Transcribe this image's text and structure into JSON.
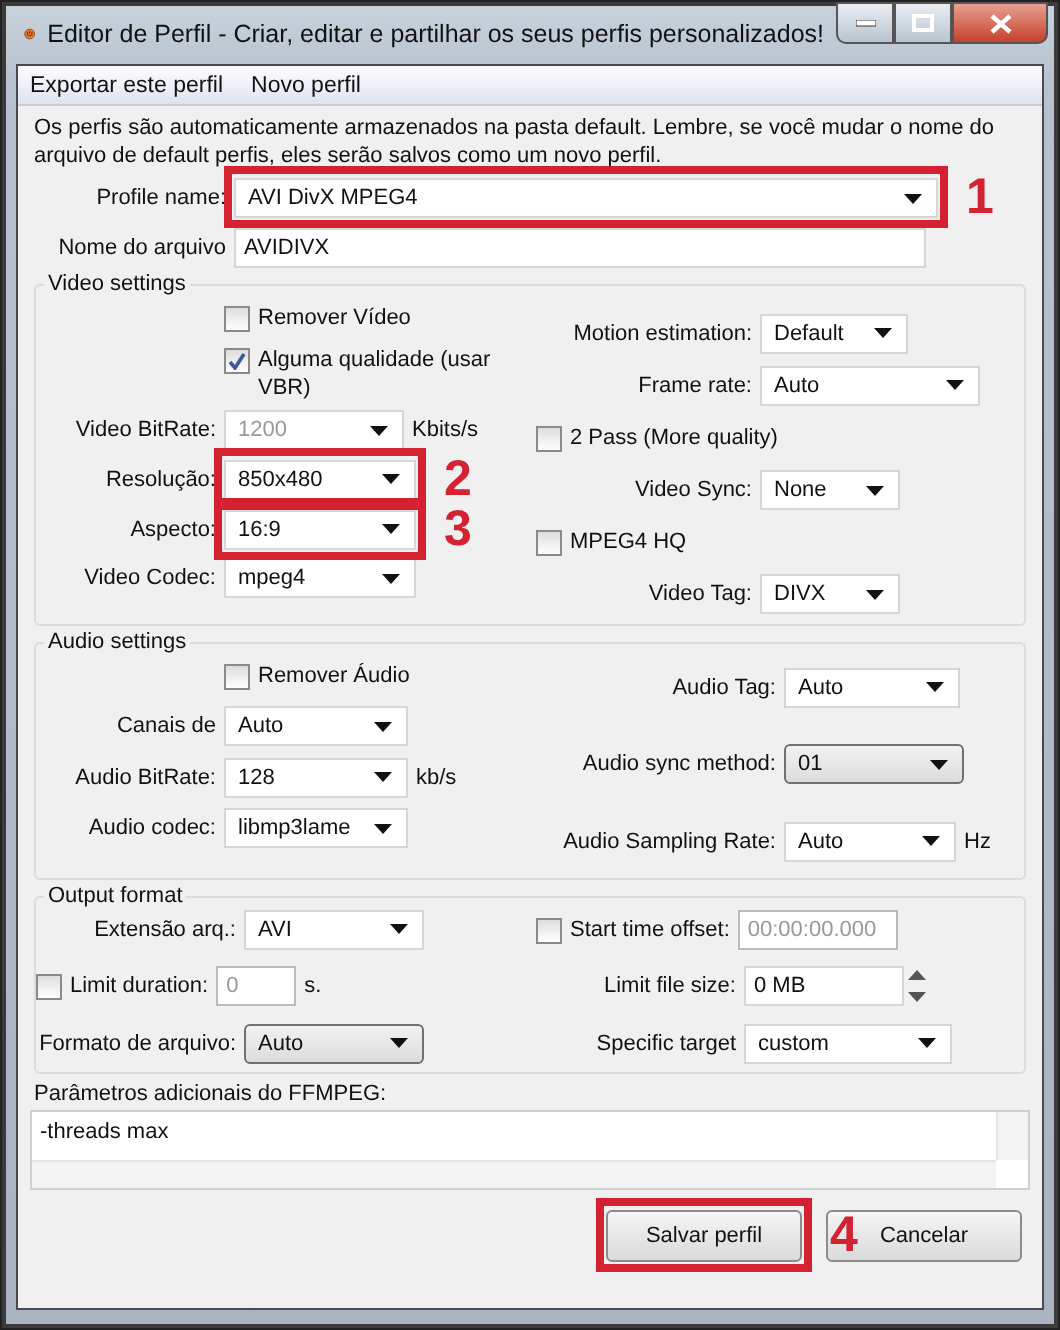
{
  "window": {
    "title": "Editor de Perfil - Criar, editar e partilhar os seus perfis personalizados!"
  },
  "menu": [
    "Exportar este perfil",
    "Novo perfil"
  ],
  "info": "Os perfis são automaticamente armazenados na pasta default. Lembre, se você mudar o nome do arquivo de default perfis, eles serão salvos como um novo perfil.",
  "profile_name": {
    "label": "Profile name:",
    "value": "AVI DivX MPEG4",
    "annotation": "1"
  },
  "file_name": {
    "label": "Nome do arquivo",
    "value": "AVIDIVX"
  },
  "sections": [
    {
      "title": "Video settings",
      "left": [
        {
          "kind": "checkbox",
          "label": "Remover Vídeo",
          "checked": false
        },
        {
          "kind": "checkbox",
          "label": "Alguma qualidade (usar VBR)",
          "checked": true
        },
        {
          "kind": "select",
          "label": "Video BitRate:",
          "value": "1200",
          "unit": "Kbits/s",
          "disabled": true
        },
        {
          "kind": "select",
          "label": "Resolução:",
          "value": "850x480",
          "annotation": "2"
        },
        {
          "kind": "select",
          "label": "Aspecto:",
          "value": "16:9",
          "annotation": "3"
        },
        {
          "kind": "select",
          "label": "Video Codec:",
          "value": "mpeg4"
        }
      ],
      "right": [
        {
          "kind": "select",
          "label": "Motion estimation:",
          "value": "Default"
        },
        {
          "kind": "select",
          "label": "Frame rate:",
          "value": "Auto"
        },
        {
          "kind": "checkbox",
          "label": "2 Pass (More quality)",
          "checked": false
        },
        {
          "kind": "select",
          "label": "Video Sync:",
          "value": "None"
        },
        {
          "kind": "checkbox",
          "label": "MPEG4 HQ",
          "checked": false
        },
        {
          "kind": "select",
          "label": "Video Tag:",
          "value": "DIVX"
        }
      ]
    },
    {
      "title": "Audio settings",
      "left": [
        {
          "kind": "checkbox",
          "label": "Remover Áudio",
          "checked": false
        },
        {
          "kind": "select",
          "label": "Canais de",
          "value": "Auto"
        },
        {
          "kind": "select",
          "label": "Audio BitRate:",
          "value": "128",
          "unit": "kb/s"
        },
        {
          "kind": "select",
          "label": "Audio codec:",
          "value": "libmp3lame"
        }
      ],
      "right": [
        {
          "kind": "select",
          "label": "Audio Tag:",
          "value": "Auto"
        },
        {
          "kind": "combo-button",
          "label": "Audio sync method:",
          "value": "01"
        },
        {
          "kind": "select",
          "label": "Audio Sampling Rate:",
          "value": "Auto",
          "unit": "Hz"
        }
      ]
    },
    {
      "title": "Output format",
      "left": [
        {
          "kind": "select",
          "label": "Extensão arq.:",
          "value": "AVI"
        },
        {
          "kind": "check-field",
          "label": "Limit duration:",
          "checked": false,
          "value": "0",
          "disabled": true,
          "unit": "s."
        },
        {
          "kind": "combo-button",
          "label": "Formato de arquivo:",
          "value": "Auto"
        }
      ],
      "right": [
        {
          "kind": "check-field",
          "label": "Start time offset:",
          "checked": false,
          "value": "00:00:00.000",
          "disabled": true
        },
        {
          "kind": "spin",
          "label": "Limit file size:",
          "value": "0 MB"
        },
        {
          "kind": "select",
          "label": "Specific target",
          "value": "custom"
        }
      ]
    }
  ],
  "ffmpeg": {
    "label": "Parâmetros adicionais do FFMPEG:",
    "value": "-threads max"
  },
  "buttons": [
    {
      "label": "Salvar perfil",
      "annotation": "4"
    },
    {
      "label": "Cancelar"
    }
  ]
}
